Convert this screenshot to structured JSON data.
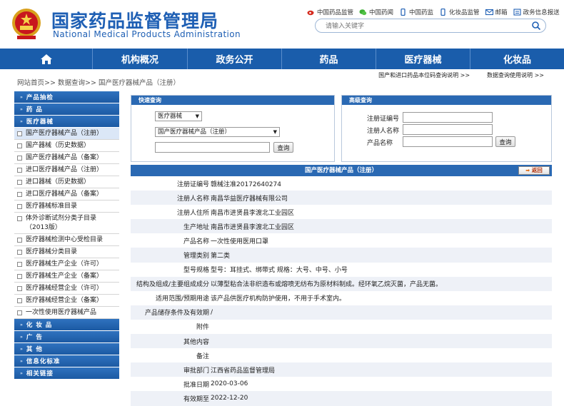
{
  "header": {
    "title": "国家药品监督管理局",
    "subtitle": "National Medical Products Administration",
    "top_links": [
      {
        "label": "中国药品监管",
        "icon": "weibo-icon"
      },
      {
        "label": "中国药闻",
        "icon": "wechat-icon"
      },
      {
        "label": "中国药监",
        "icon": "phone-icon"
      },
      {
        "label": "化妆品监管",
        "icon": "phone-icon"
      },
      {
        "label": "邮箱",
        "icon": "mail-icon"
      },
      {
        "label": "政务信息报送",
        "icon": "report-icon"
      }
    ],
    "search_placeholder": "请输入关键字"
  },
  "nav": {
    "items": [
      "机构概况",
      "政务公开",
      "药品",
      "医疗器械",
      "化妆品"
    ]
  },
  "breadcrumb": {
    "home": "网站首页",
    "sep": ">>",
    "level1": "数据查询",
    "level2": "国产医疗器械产品（注册）"
  },
  "help_links": {
    "left": "国产和进口药品本位码查询说明 >>",
    "right": "数据查询使用说明 >>"
  },
  "sidebar": {
    "categories": {
      "cat1": "产品抽检",
      "cat2": "药    品",
      "cat3": "医疗器械",
      "cat4": "化 妆 品",
      "cat5": "广    告",
      "cat6": "其    他",
      "cat7": "信息化标准",
      "cat8": "相关链接"
    },
    "items": [
      {
        "label": "国产医疗器械产品（注册）"
      },
      {
        "label": "国产器械（历史数据）"
      },
      {
        "label": "国产医疗器械产品（备案）"
      },
      {
        "label": "进口医疗器械产品（注册）"
      },
      {
        "label": "进口器械（历史数据）"
      },
      {
        "label": "进口医疗器械产品（备案）"
      },
      {
        "label": "医疗器械标准目录"
      },
      {
        "label": "体外诊断试剂分类子目录（2013版）"
      },
      {
        "label": "医疗器械检测中心受检目录"
      },
      {
        "label": "医疗器械分类目录"
      },
      {
        "label": "医疗器械生产企业（许可）"
      },
      {
        "label": "医疗器械生产企业（备案）"
      },
      {
        "label": "医疗器械经营企业（许可）"
      },
      {
        "label": "医疗器械经营企业（备案）"
      },
      {
        "label": "一次性使用医疗器械产品"
      }
    ]
  },
  "quick_query": {
    "title": "快速查询",
    "select1": "医疗器械",
    "select2": "国产医疗器械产品（注册）",
    "button": "查询"
  },
  "advanced_query": {
    "title": "高级查询",
    "field1": "注册证编号",
    "field2": "注册人名称",
    "field3": "产品名称",
    "button": "查询"
  },
  "detail": {
    "title": "国产医疗器械产品（注册）",
    "back": "返回",
    "rows": [
      {
        "label": "注册证编号",
        "value": "赣械注准20172640274"
      },
      {
        "label": "注册人名称",
        "value": "南昌华益医疗器械有限公司"
      },
      {
        "label": "注册人住所",
        "value": "南昌市进贤县李渡北工业园区"
      },
      {
        "label": "生产地址",
        "value": "南昌市进贤县李渡北工业园区"
      },
      {
        "label": "产品名称",
        "value": "一次性使用医用口罩"
      },
      {
        "label": "管理类别",
        "value": "第二类"
      },
      {
        "label": "型号规格",
        "value": "型号：耳挂式、绑带式 规格：大号、中号、小号"
      },
      {
        "label": "结构及组成/主要组成成分",
        "value": "以薄型粘合法非织造布或熔喷无纺布为原材料制成。经环氧乙烷灭菌，产品无菌。"
      },
      {
        "label": "适用范围/预期用途",
        "value": "该产品供医疗机构防护使用，不用于手术室内。"
      },
      {
        "label": "产品储存条件及有效期",
        "value": "/"
      },
      {
        "label": "附件",
        "value": ""
      },
      {
        "label": "其他内容",
        "value": ""
      },
      {
        "label": "备注",
        "value": ""
      },
      {
        "label": "审批部门",
        "value": "江西省药品监督管理局"
      },
      {
        "label": "批准日期",
        "value": "2020-03-06"
      },
      {
        "label": "有效期至",
        "value": "2022-12-20"
      }
    ]
  }
}
